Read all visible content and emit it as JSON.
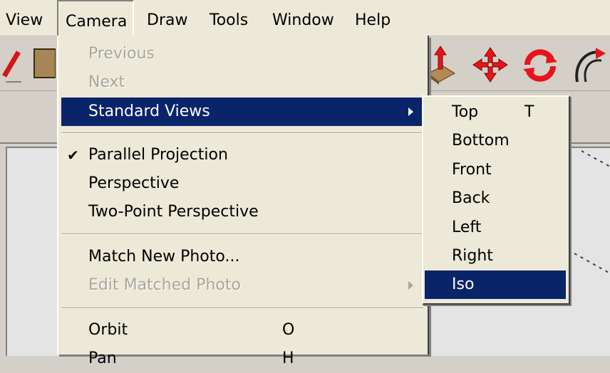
{
  "menubar": {
    "items": [
      "View",
      "Camera",
      "Draw",
      "Tools",
      "Window",
      "Help"
    ]
  },
  "camera_menu": {
    "previous": "Previous",
    "next": "Next",
    "standard_views": "Standard Views",
    "parallel_projection": "Parallel Projection",
    "perspective": "Perspective",
    "two_point_perspective": "Two-Point Perspective",
    "match_new_photo": "Match New Photo...",
    "edit_matched_photo": "Edit Matched Photo",
    "orbit": "Orbit",
    "orbit_shortcut": "O",
    "pan_partial": "Pan",
    "pan_shortcut": "H"
  },
  "standard_views_submenu": {
    "top": "Top",
    "top_shortcut": "T",
    "bottom": "Bottom",
    "front": "Front",
    "back": "Back",
    "left": "Left",
    "right": "Right",
    "iso": "Iso"
  },
  "icons": {
    "check": "checkmark-icon",
    "submenu_arrow": "chevron-right-icon"
  },
  "colors": {
    "highlight": "#0a246a",
    "menu_bg": "#ece9d8",
    "disabled_text": "#a9a69b",
    "tool_red": "#e8141c"
  }
}
